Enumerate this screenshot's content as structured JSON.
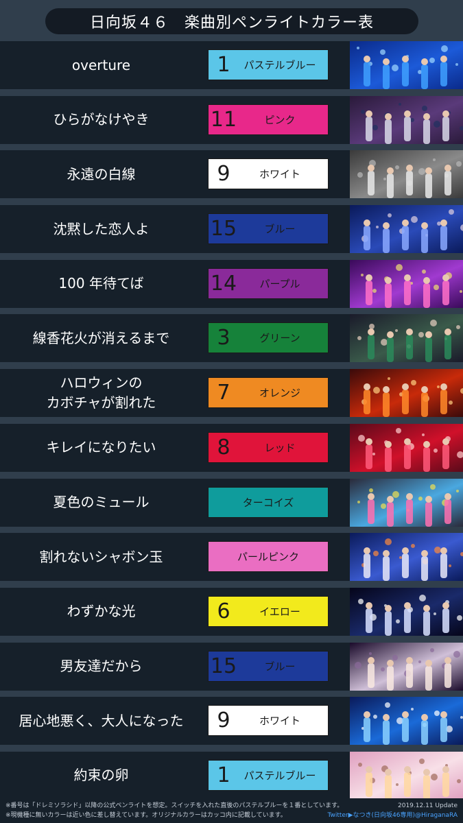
{
  "title": "日向坂４６　楽曲別ペンライトカラー表",
  "rows": [
    {
      "song": "overture",
      "num": "1",
      "color_name": "パステルブルー",
      "bg": "#5bc6e8",
      "fg": "#1a1a1a",
      "photo": "concert-crowd-blue"
    },
    {
      "song": "ひらがなけやき",
      "num": "11",
      "color_name": "ピンク",
      "bg": "#e8288a",
      "fg": "#1a1a1a",
      "photo": "group-on-stage"
    },
    {
      "song": "永遠の白線",
      "num": "9",
      "color_name": "ホワイト",
      "bg": "#ffffff",
      "fg": "#1a1a1a",
      "photo": "group-white-stage"
    },
    {
      "song": "沈黙した恋人よ",
      "num": "15",
      "color_name": "ブルー",
      "bg": "#1d3a9a",
      "fg": "#1a1a1a",
      "photo": "stage-blue-lights"
    },
    {
      "song": "100 年待てば",
      "num": "14",
      "color_name": "パープル",
      "bg": "#8a2a9a",
      "fg": "#1a1a1a",
      "photo": "arena-purple"
    },
    {
      "song": "線香花火が消えるまで",
      "num": "3",
      "color_name": "グリーン",
      "bg": "#16823a",
      "fg": "#1a1a1a",
      "photo": "three-members-green"
    },
    {
      "song": "ハロウィンの\nカボチャが割れた",
      "num": "7",
      "color_name": "オレンジ",
      "bg": "#ef8a22",
      "fg": "#1a1a1a",
      "photo": "arena-orange"
    },
    {
      "song": "キレイになりたい",
      "num": "8",
      "color_name": "レッド",
      "bg": "#e0143a",
      "fg": "#1a1a1a",
      "photo": "red-stage-set"
    },
    {
      "song": "夏色のミュール",
      "num": "",
      "color_name": "ターコイズ",
      "bg": "#0f9c9c",
      "fg": "#1a1a1a",
      "photo": "three-members-summer"
    },
    {
      "song": "割れないシャボン玉",
      "num": "",
      "color_name": "パールピンク",
      "bg": "#ea6ec2",
      "fg": "#1a1a1a",
      "photo": "members-rainbow-dress"
    },
    {
      "song": "わずかな光",
      "num": "6",
      "color_name": "イエロー",
      "bg": "#f2ea1c",
      "fg": "#1a1a1a",
      "photo": "moon-stage"
    },
    {
      "song": "男友達だから",
      "num": "15",
      "color_name": "ブルー",
      "bg": "#1d3a9a",
      "fg": "#1a1a1a",
      "photo": "singer-closeup"
    },
    {
      "song": "居心地悪く、大人になった",
      "num": "9",
      "color_name": "ホワイト",
      "bg": "#ffffff",
      "fg": "#1a1a1a",
      "photo": "solo-blue-stage"
    },
    {
      "song": "約束の卵",
      "num": "1",
      "color_name": "パステルブルー",
      "bg": "#5bc6e8",
      "fg": "#1a1a1a",
      "photo": "members-heart-hands"
    }
  ],
  "footer": {
    "note1": "※番号は「ドレミソラシド」以降の公式ペンライトを想定。スイッチを入れた直後のパステルブルーを１番としています。",
    "update": "2019.12.11 Update",
    "note2": "※現機種に無いカラーは近い色に差し替えています。オリジナルカラーはカッコ内に記載しています。",
    "twitter": "Twitter▶なつき(日向坂46専用)@HiraganaRA"
  }
}
